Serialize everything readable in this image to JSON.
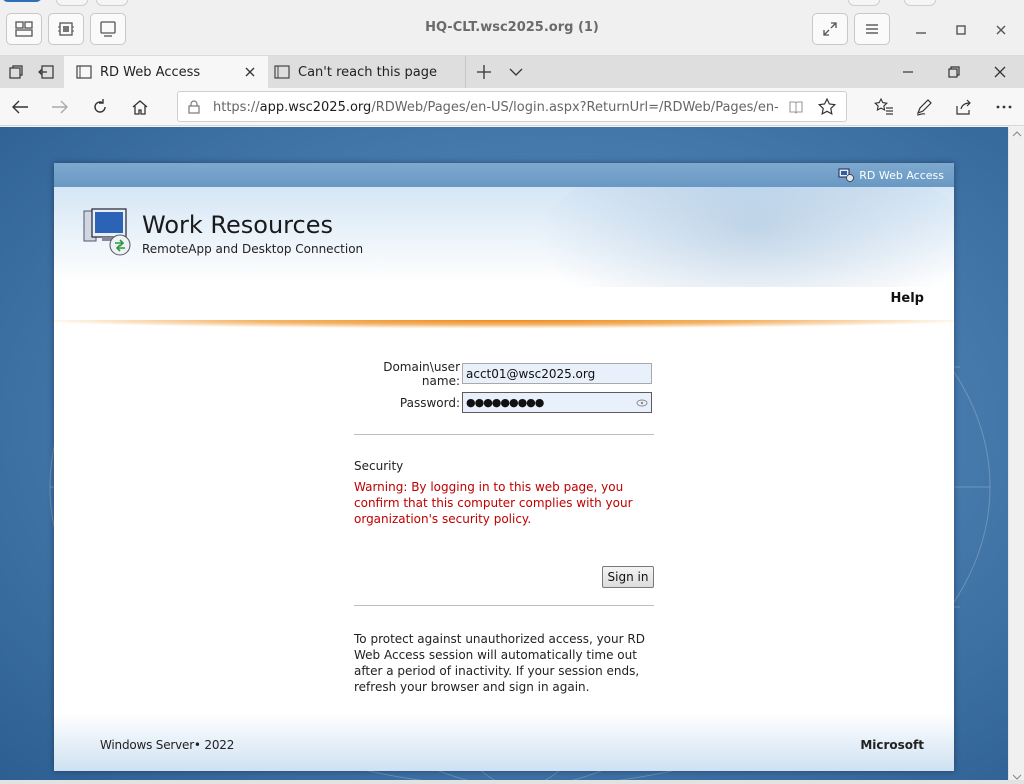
{
  "vm_window": {
    "title": "HQ-CLT.wsc2025.org (1)"
  },
  "browser": {
    "tabs": [
      {
        "label": "RD Web Access",
        "active": true
      },
      {
        "label": "Can't reach this page",
        "active": false
      }
    ],
    "url_domain": "app.wsc2025.org",
    "url_prefix": "https://",
    "url_path": "/RDWeb/Pages/en-US/login.aspx?ReturnUrl=/RDWeb/Pages/en-US/Defau"
  },
  "page": {
    "top_label": "RD Web Access",
    "title": "Work Resources",
    "subtitle": "RemoteApp and Desktop Connection",
    "help_label": "Help",
    "form": {
      "username_label": "Domain\\user name:",
      "username_value": "acct01@wsc2025.org",
      "password_label": "Password:",
      "password_value": "●●●●●●●●●",
      "security_title": "Security",
      "warning": "Warning: By logging in to this web page, you confirm that this computer complies with your organization's security policy.",
      "signin_label": "Sign in",
      "timeout_note": "To protect against unauthorized access, your RD Web Access session will automatically time out after a period of inactivity. If your session ends, refresh your browser and sign in again."
    },
    "footer_left": "Windows Server• 2022",
    "footer_right": "Microsoft"
  },
  "colors": {
    "warning_text": "#c00000",
    "accent_orange": "#ee8a1a",
    "background_blue": "#4a7db0"
  }
}
